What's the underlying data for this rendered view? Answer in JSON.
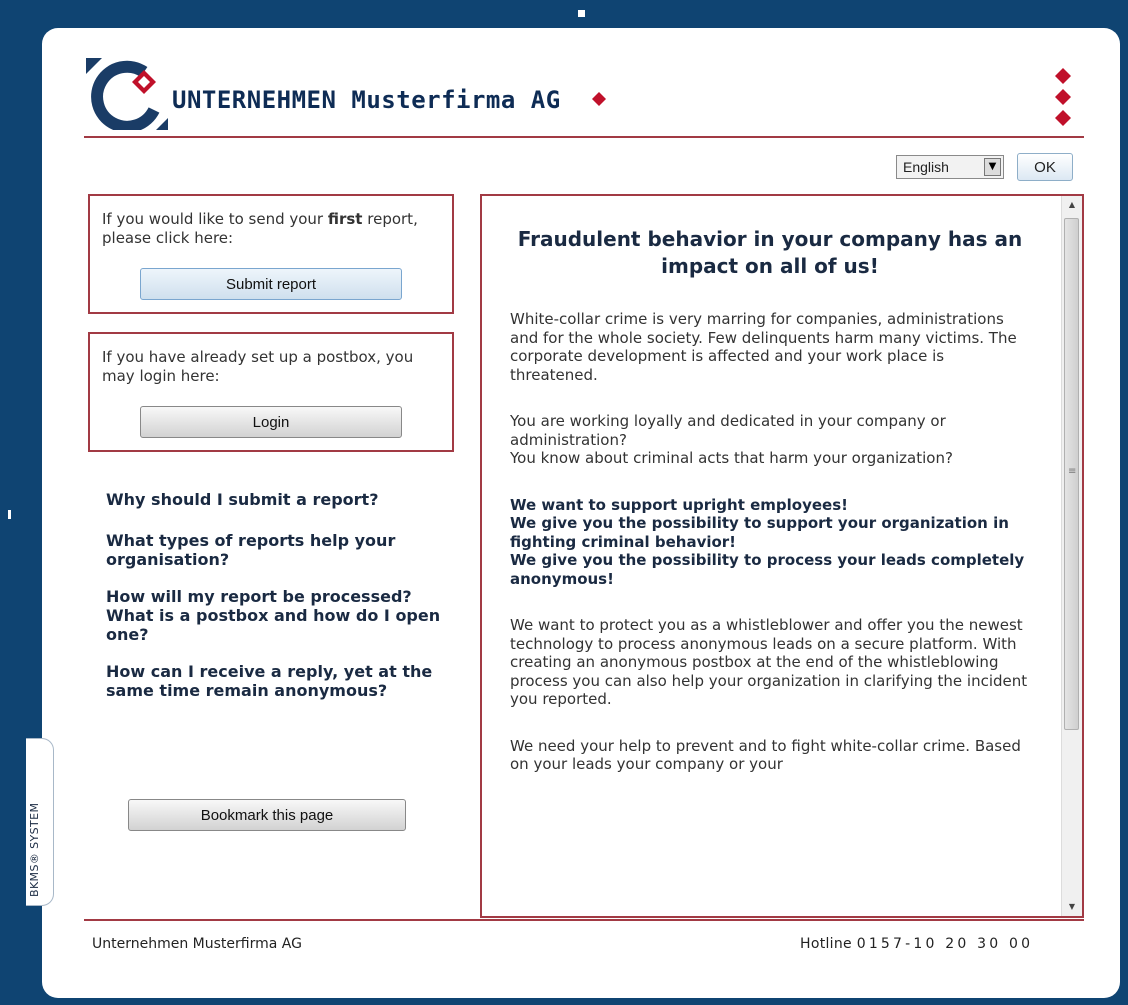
{
  "header": {
    "company_name": "UNTERNEHMEN Musterfirma AG"
  },
  "language": {
    "selected": "English",
    "ok_label": "OK"
  },
  "submit_box": {
    "text_before": "If you would like to send your ",
    "text_bold": "first",
    "text_after": " report, please click here:",
    "button_label": "Submit report"
  },
  "login_box": {
    "text": "If you have already set up a postbox, you may login here:",
    "button_label": "Login"
  },
  "faq": [
    "Why should I submit a report?",
    "What types of reports help your organisation?",
    "How will my report be processed? What is a postbox and how do I open one?",
    "How can I receive a reply, yet at the same time remain anonymous?"
  ],
  "bookmark_label": "Bookmark this page",
  "side_tab_label": "BKMS® SYSTEM",
  "content": {
    "title": "Fraudulent behavior in your company has an impact on all of us!",
    "para1": "White-collar crime is very marring for companies, administrations and for the whole society. Few delinquents harm many victims. The corporate development is affected and your work place is threatened.",
    "para2_line1": "You are working loyally and dedicated in your company or administration?",
    "para2_line2": "You know about criminal acts that harm your organization?",
    "bold_line1": "We want to support upright employees!",
    "bold_line2": "We give you the possibility to support your organization in fighting criminal behavior!",
    "bold_line3": "We give you the possibility to process your leads completely anonymous!",
    "para3": "We want to protect you as a whistleblower and offer you the newest technology to process anonymous leads on a secure platform. With creating an anonymous postbox at the end of the whistleblowing process you can also help your organization in clarifying the incident you reported.",
    "para4": "We need your help to prevent and to fight white-collar crime. Based on your leads your company or your"
  },
  "footer": {
    "company": "Unternehmen Musterfirma AG",
    "hotline_label": "Hotline",
    "hotline_number": "0157-10 20 30 00"
  },
  "colors": {
    "frame_blue": "#0f4472",
    "accent_red": "#a23a44",
    "logo_blue": "#1a3c66",
    "diamond_red": "#c0102a"
  },
  "icons": {
    "logo": "company-logo-icon",
    "diamond": "diamond-icon",
    "dropdown": "dropdown-arrow-icon",
    "scroll_up": "scroll-up-arrow-icon",
    "scroll_down": "scroll-down-arrow-icon"
  }
}
